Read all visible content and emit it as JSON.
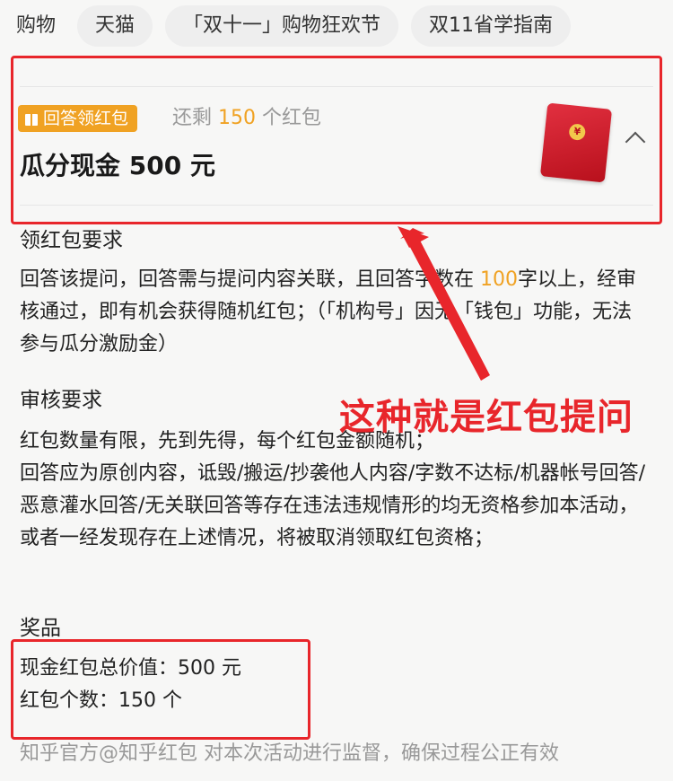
{
  "tags": [
    "购物",
    "天猫",
    "「双十一」购物狂欢节",
    "双11省学指南"
  ],
  "card": {
    "badge_label": "回答领红包",
    "remain_prefix": "还剩",
    "remain_count": "150",
    "remain_suffix": "个红包",
    "title": "瓜分现金 500 元"
  },
  "requirements": {
    "heading": "领红包要求",
    "text_pre": "回答该提问，回答需与提问内容关联，且回答字数在",
    "text_num": "100",
    "text_post": "字以上，经审核通过，即有机会获得随机红包；（「机构号」因无「钱包」功能，无法参与瓜分激励金）"
  },
  "review": {
    "heading": "审核要求",
    "line1": "红包数量有限，先到先得，每个红包金额随机；",
    "line2": "回答应为原创内容，诋毁/搬运/抄袭他人内容/字数不达标/机器帐号回答/恶意灌水回答/无关联回答等存在违法违规情形的均无资格参加本活动，或者一经发现存在上述情况，将被取消领取红包资格；"
  },
  "prize": {
    "heading": "奖品",
    "total": "现金红包总价值：500 元",
    "count": "红包个数：150 个"
  },
  "footer": "知乎官方@知乎红包 对本次活动进行监督，确保过程公正有效",
  "annotation": "这种就是红包提问",
  "colors": {
    "accent_red": "#e8262b",
    "badge_orange": "#f0a223"
  }
}
